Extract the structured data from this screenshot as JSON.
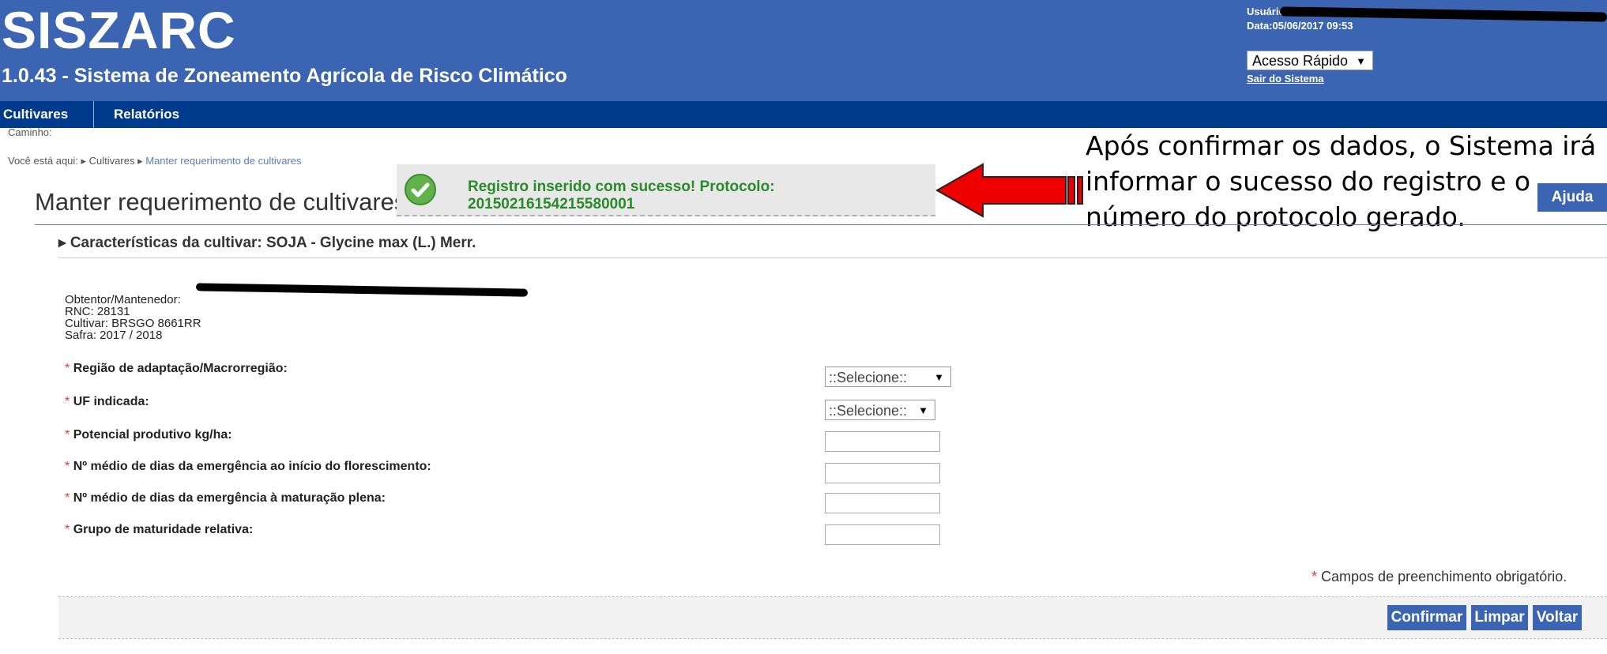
{
  "header": {
    "logo": "SISZARC",
    "subtitle": "1.0.43 - Sistema de Zoneamento Agrícola de Risco Climático",
    "user_label": "Usuário:",
    "date": "Data:05/06/2017 09:53",
    "quick_access": "Acesso Rápido",
    "logout": "Sair do Sistema"
  },
  "nav": {
    "items": [
      "Cultivares",
      "Relatórios"
    ]
  },
  "path_label": "Caminho:",
  "breadcrumb": {
    "prefix": "Você está aqui:",
    "items": [
      "Cultivares",
      "Manter requerimento de cultivares"
    ]
  },
  "page_title": "Manter requerimento de cultivares",
  "success_message": "Registro inserido com sucesso! Protocolo: 20150216154215580001",
  "callout": {
    "line1": "Após confirmar os dados, o Sistema irá",
    "line2": "informar o sucesso do registro e o",
    "line3": "número do protocolo gerado."
  },
  "help_button": "Ajuda",
  "section_title": "Características da cultivar: SOJA - Glycine max (L.) Merr.",
  "info": {
    "obtentor": "Obtentor/Mantenedor:",
    "rnc": "RNC: 28131",
    "cultivar": "Cultivar: BRSGO 8661RR",
    "safra": "Safra: 2017 / 2018"
  },
  "fields": {
    "regiao": "Região de adaptação/Macrorregião:",
    "uf": "UF indicada:",
    "potencial": "Potencial produtivo kg/ha:",
    "florescimento": "Nº médio de dias da emergência ao início do florescimento:",
    "maturacao": "Nº médio de dias da emergência à maturação plena:",
    "grupo": "Grupo de maturidade relativa:"
  },
  "select_placeholder": "::Selecione::",
  "required_marker": "*",
  "required_note": "Campos de preenchimento obrigatório.",
  "buttons": {
    "confirm": "Confirmar",
    "clear": "Limpar",
    "back": "Voltar"
  },
  "colors": {
    "header": "#3b64b3",
    "nav": "#003a8c",
    "success_text": "#2a8a2a",
    "callout_arrow": "#ee0000"
  }
}
